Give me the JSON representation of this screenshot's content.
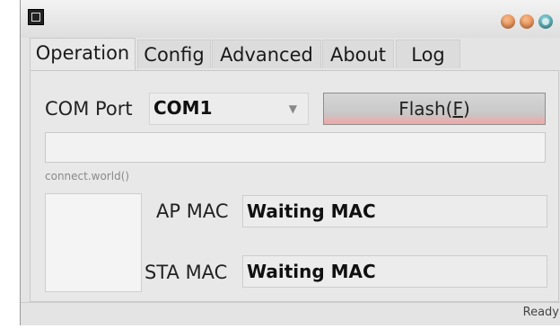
{
  "tabs": [
    {
      "label": "Operation"
    },
    {
      "label": "Config"
    },
    {
      "label": "Advanced"
    },
    {
      "label": "About"
    },
    {
      "label": "Log"
    }
  ],
  "operation": {
    "com_port_label": "COM Port",
    "com_port_value": "COM1",
    "flash_label_prefix": "Flash(",
    "flash_mnemonic": "F",
    "flash_label_suffix": ")",
    "status_text": "connect.world()",
    "ap_mac_label": "AP MAC",
    "ap_mac_value": "Waiting MAC",
    "sta_mac_label": "STA MAC",
    "sta_mac_value": "Waiting MAC"
  },
  "statusbar": {
    "text": "Ready"
  },
  "icons": {
    "app": "app-icon",
    "minimize": "minimize-icon",
    "maximize": "maximize-icon",
    "close": "close-icon",
    "dropdown": "chevron-down-icon"
  },
  "colors": {
    "window_bg": "#e4e4e4",
    "flash_accent": "#f1a6a6",
    "minimize": "#e27b3c",
    "close": "#3d9aa5"
  }
}
